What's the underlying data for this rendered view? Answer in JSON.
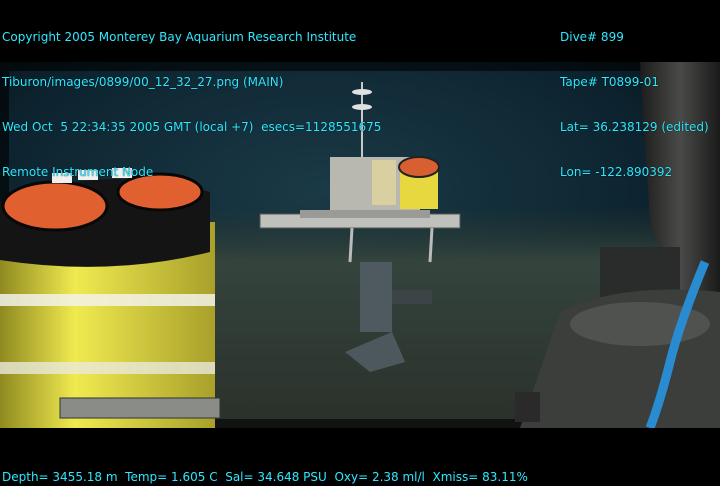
{
  "overlay": {
    "top_left": [
      "Copyright 2005 Monterey Bay Aquarium Research Institute",
      "Tiburon/images/0899/00_12_32_27.png (MAIN)",
      "Wed Oct  5 22:34:35 2005 GMT (local +7)  esecs=1128551675",
      "Remote Instrument Node"
    ],
    "top_right": [
      "Dive# 899",
      "Tape# T0899-01",
      "Lat= 36.238129 (edited)",
      "Lon= -122.890392"
    ],
    "bottom": "Depth= 3455.18 m  Temp= 1.605 C  Sal= 34.648 PSU  Oxy= 2.38 ml/l  Xmiss= 83.11%"
  },
  "colors": {
    "overlay_text": "#2ee8ff",
    "water": "#0e2a35",
    "seafloor": "#3d4a44",
    "float_yellow": "#e8e040",
    "float_orange": "#e06030"
  },
  "scene": {
    "subjects": [
      "yellow-float-housing",
      "remote-instrument-node",
      "rov-manipulator-arm",
      "blue-cable"
    ]
  }
}
